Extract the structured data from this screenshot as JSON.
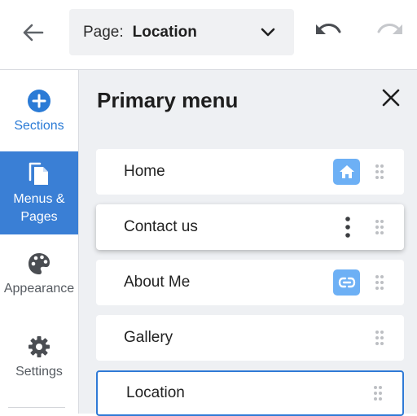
{
  "header": {
    "page_label": "Page:",
    "page_value": "Location"
  },
  "sidebar": {
    "items": [
      {
        "label": "Sections",
        "icon": "plus-circle-icon"
      },
      {
        "label": "Menus & Pages",
        "icon": "pages-icon",
        "active": true
      },
      {
        "label": "Appearance",
        "icon": "palette-icon"
      },
      {
        "label": "Settings",
        "icon": "gear-icon"
      }
    ]
  },
  "panel": {
    "title": "Primary menu",
    "items": [
      {
        "label": "Home",
        "icon": "home-icon"
      },
      {
        "label": "Contact us",
        "icon": "more-vertical-icon"
      },
      {
        "label": "About Me",
        "icon": "link-icon"
      },
      {
        "label": "Gallery"
      },
      {
        "label": "Location",
        "selected": true
      }
    ]
  },
  "colors": {
    "accent": "#3a7fd5",
    "badge": "#6db0f5",
    "panel_bg": "#eef0f3"
  }
}
